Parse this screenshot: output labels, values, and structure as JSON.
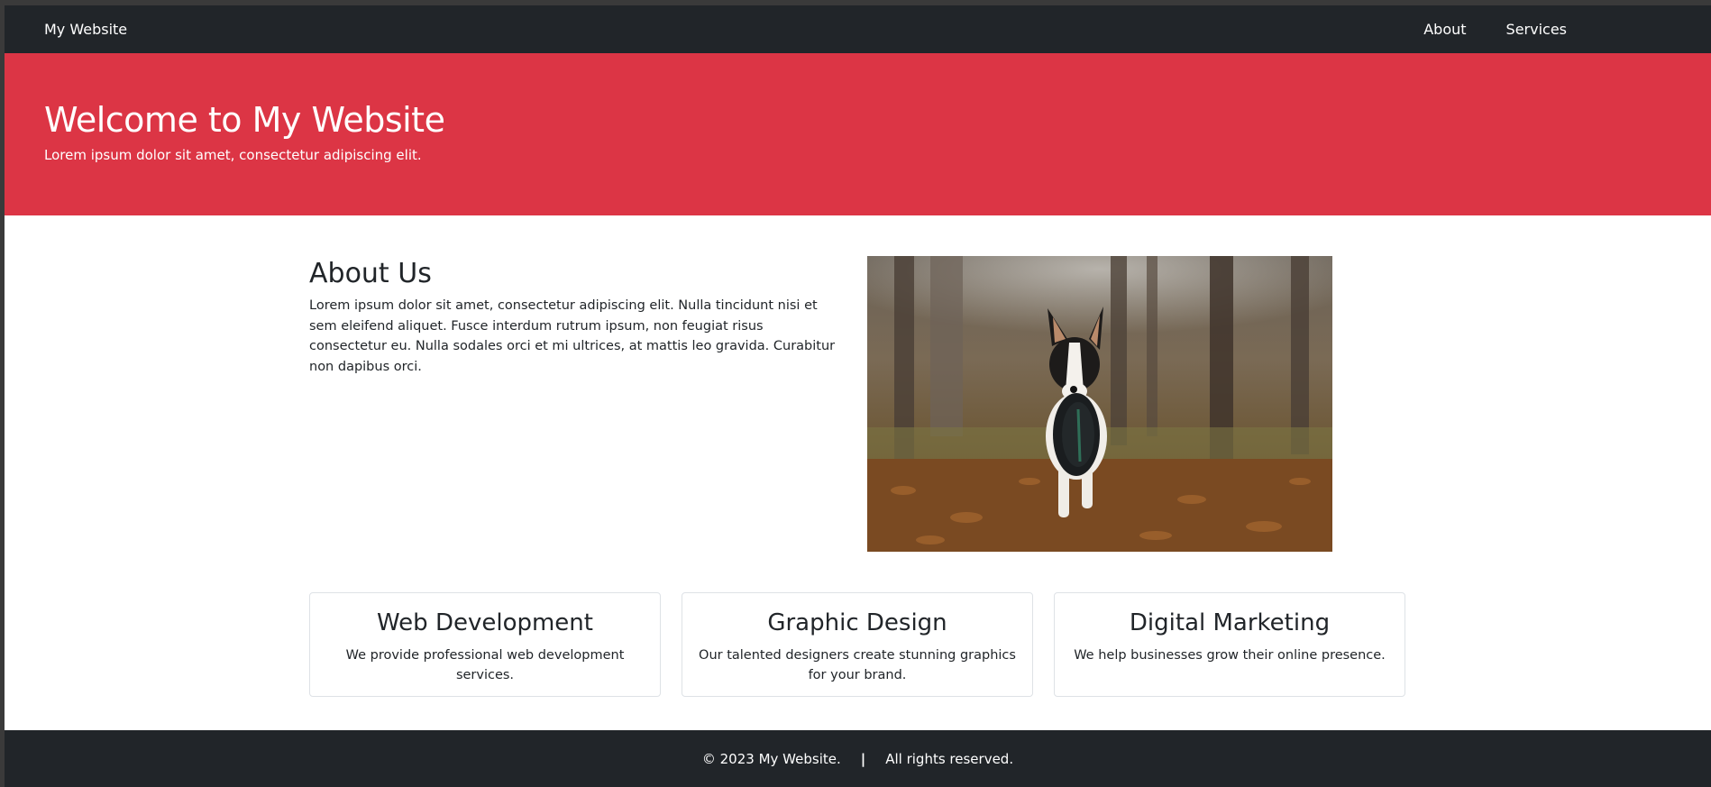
{
  "navbar": {
    "brand": "My Website",
    "links": [
      "About",
      "Services"
    ]
  },
  "hero": {
    "title": "Welcome to My Website",
    "subtitle": "Lorem ipsum dolor sit amet, consectetur adipiscing elit."
  },
  "about": {
    "title": "About Us",
    "text": "Lorem ipsum dolor sit amet, consectetur adipiscing elit. Nulla tincidunt nisi et sem eleifend aliquet. Fusce interdum rutrum ipsum, non feugiat risus consectetur eu. Nulla sodales orci et mi ultrices, at mattis leo gravida. Curabitur non dapibus orci.",
    "image_icon": "dog-with-frisbee-photo"
  },
  "services": [
    {
      "title": "Web Development",
      "text": "We provide professional web development services."
    },
    {
      "title": "Graphic Design",
      "text": "Our talented designers create stunning graphics for your brand."
    },
    {
      "title": "Digital Marketing",
      "text": "We help businesses grow their online presence."
    }
  ],
  "footer": {
    "copyright": "© 2023 My Website.",
    "separator": "|",
    "rights": "All rights reserved."
  },
  "colors": {
    "navbar": "#212529",
    "hero": "#dc3545",
    "text": "#212529",
    "card_border": "#dee2e6"
  }
}
